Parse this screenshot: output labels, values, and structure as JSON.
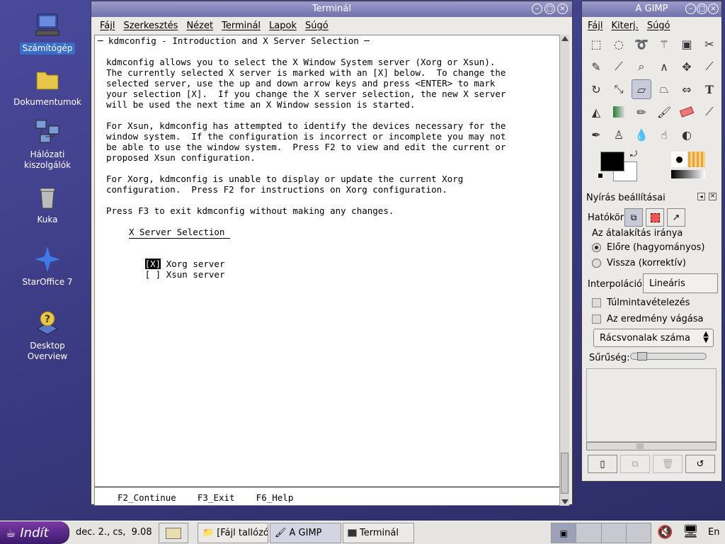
{
  "desktop": {
    "icons": [
      {
        "label": "Számítógép",
        "icon": "computer-icon"
      },
      {
        "label": "Dokumentumok",
        "icon": "folder-icon"
      },
      {
        "label": "Hálózati kiszolgálók",
        "icon": "network-icon"
      },
      {
        "label": "Kuka",
        "icon": "trash-icon"
      },
      {
        "label": "StarOffice 7",
        "icon": "staroffice-icon"
      },
      {
        "label": "Desktop Overview",
        "icon": "help-icon"
      }
    ]
  },
  "terminal": {
    "title": "Terminál",
    "menu": [
      "Fájl",
      "Szerkesztés",
      "Nézet",
      "Terminál",
      "Lapok",
      "Súgó"
    ],
    "lines": [
      "─ kdmconfig - Introduction and X Server Selection ─",
      "kdmconfig allows you to select the X Window System server (Xorg or Xsun).",
      "The currently selected X server is marked with an [X] below.  To change the",
      "selected server, use the up and down arrow keys and press <ENTER> to mark",
      "your selection [X].  If you change the X server selection, the new X server",
      "will be used the next time an X Window session is started.",
      "For Xsun, kdmconfig has attempted to identify the devices necessary for the",
      "window system.  If the configuration is incorrect or incomplete you may not",
      "be able to use the window system.  Press F2 to view and edit the current or",
      "proposed Xsun configuration.",
      "For Xorg, kdmconfig is unable to display or update the current Xorg",
      "configuration.  Press F2 for instructions on Xorg configuration.",
      "Press F3 to exit kdmconfig without making any changes."
    ],
    "selection_title": "X Server Selection",
    "options": [
      {
        "mark": "[X]",
        "label": "Xorg server"
      },
      {
        "mark": "[ ]",
        "label": "Xsun server"
      }
    ],
    "footer": "F2_Continue    F3_Exit    F6_Help"
  },
  "gimp": {
    "title": "A GIMP",
    "menu": [
      "Fájl",
      "Kiterj.",
      "Súgó"
    ],
    "tool_options_title": "Nyírás beállításai",
    "scope_label": "Hatókör:",
    "direction_label": "Az átalakítás iránya",
    "direction_options": [
      "Előre (hagyományos)",
      "Vissza (korrektív)"
    ],
    "interpolation_label": "Interpoláció:",
    "interpolation_value": "Lineáris",
    "supersampling_label": "Túlmintavételezés",
    "clip_label": "Az eredmény vágása",
    "grid_select": "Rácsvonalak száma",
    "density_label": "Sűrűség:",
    "density_level": 0.1
  },
  "taskbar": {
    "start_label": "Indít",
    "clock": "dec. 2., cs,  9.08",
    "tasks": [
      "[Fájl tallózó: /",
      "A GIMP",
      "Terminál"
    ],
    "active_task": 1,
    "lang": "En"
  }
}
